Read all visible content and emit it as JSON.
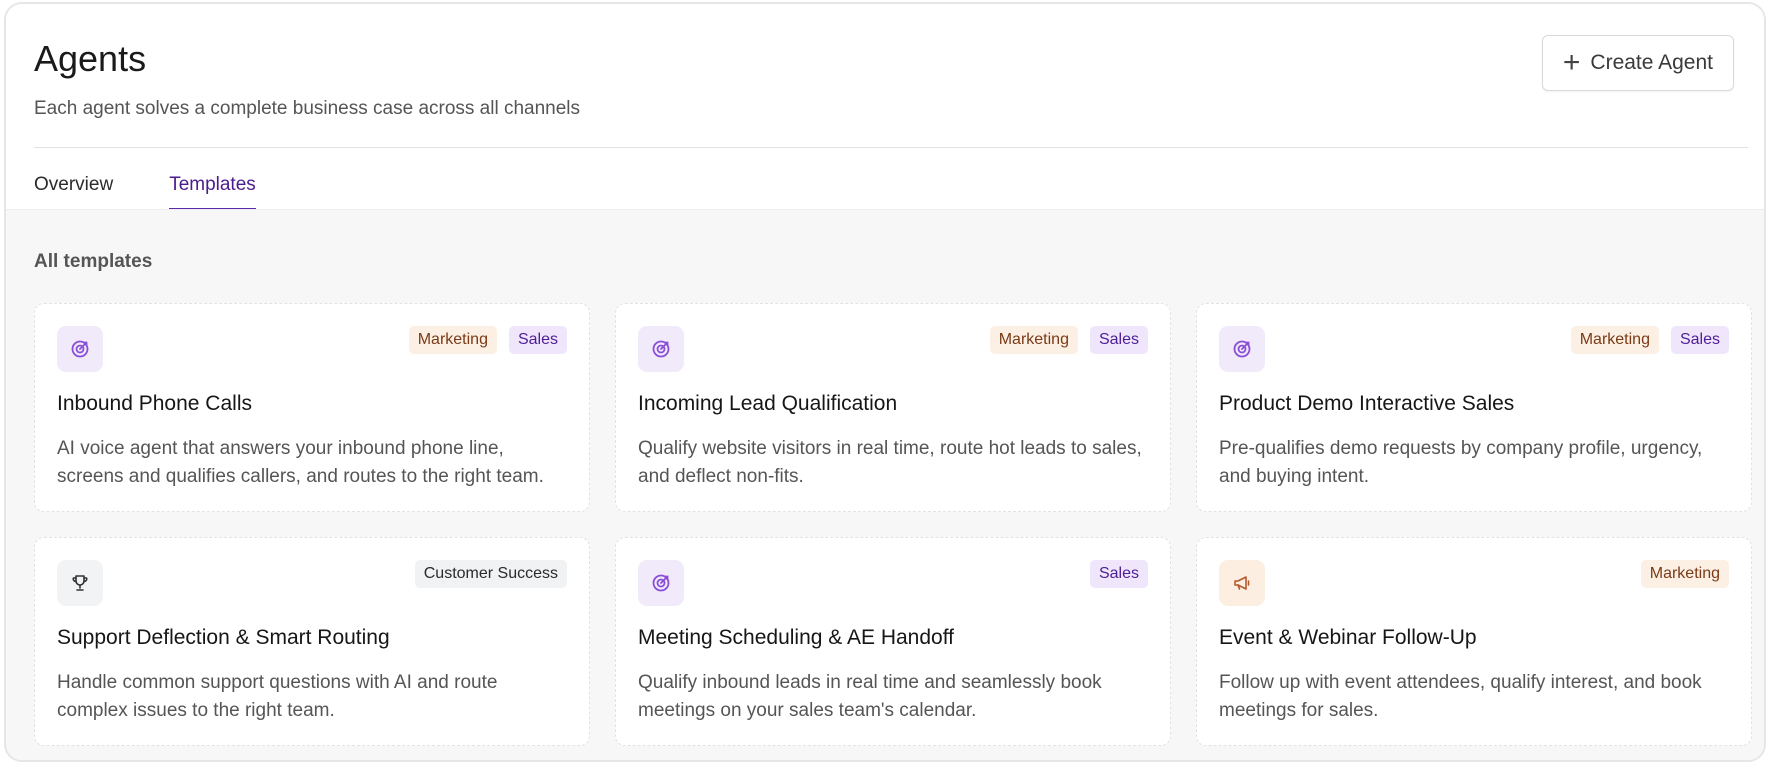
{
  "header": {
    "title": "Agents",
    "subtitle": "Each agent solves a complete business case across all channels",
    "create_label": "Create Agent"
  },
  "tabs": [
    {
      "label": "Overview",
      "active": false
    },
    {
      "label": "Templates",
      "active": true
    }
  ],
  "section_title": "All templates",
  "colors": {
    "accent": "#5b2aa8",
    "marketing_bg": "#fcefe3",
    "sales_bg": "#efe6fb"
  },
  "cards": [
    {
      "title": "Inbound Phone Calls",
      "desc": "AI voice agent that answers your inbound phone line, screens and qualifies callers, and routes to the right team.",
      "icon": "target-icon",
      "badges": [
        "Marketing",
        "Sales"
      ]
    },
    {
      "title": "Incoming Lead Qualification",
      "desc": "Qualify website visitors in real time, route hot leads to sales, and deflect non-fits.",
      "icon": "target-icon",
      "badges": [
        "Marketing",
        "Sales"
      ]
    },
    {
      "title": "Product Demo Interactive Sales",
      "desc": "Pre-qualifies demo requests by company profile, urgency, and buying intent.",
      "icon": "target-icon",
      "badges": [
        "Marketing",
        "Sales"
      ]
    },
    {
      "title": "Support Deflection & Smart Routing",
      "desc": "Handle common support questions with AI and route complex issues to the right team.",
      "icon": "trophy-icon",
      "badges": [
        "Customer Success"
      ]
    },
    {
      "title": "Meeting Scheduling & AE Handoff",
      "desc": "Qualify inbound leads in real time and seamlessly book meetings on your sales team's calendar.",
      "icon": "target-icon",
      "badges": [
        "Sales"
      ]
    },
    {
      "title": "Event & Webinar Follow-Up",
      "desc": "Follow up with event attendees, qualify interest, and book meetings for sales.",
      "icon": "megaphone-icon",
      "badges": [
        "Marketing"
      ]
    }
  ]
}
